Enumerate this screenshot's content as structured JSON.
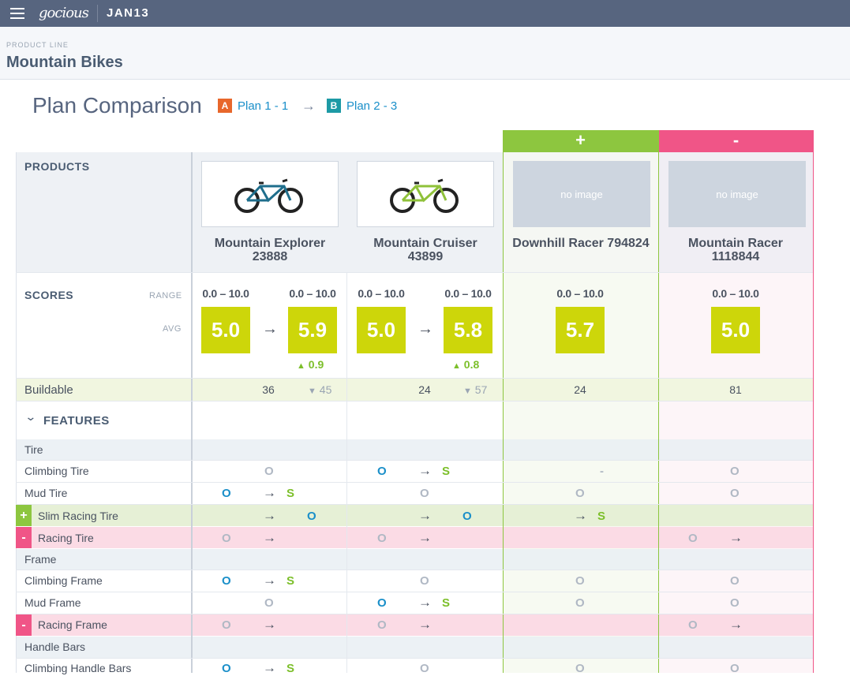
{
  "topbar": {
    "logo": "gocious",
    "project": "JAN13"
  },
  "product_line": {
    "label": "PRODUCT LINE",
    "name": "Mountain Bikes"
  },
  "page": {
    "title": "Plan Comparison"
  },
  "plans": [
    {
      "badge": "A",
      "label": "Plan 1 - 1",
      "color": "#e8672b"
    },
    {
      "badge": "B",
      "label": "Plan 2 - 3",
      "color": "#1d9aa5"
    }
  ],
  "column_headers": {
    "added": "+",
    "removed": "-"
  },
  "colors": {
    "added": "#8dc63f",
    "removed": "#f05587",
    "score": "#cdd60a",
    "link": "#1a8fc9"
  },
  "sections": {
    "products": "PRODUCTS",
    "scores": "SCORES",
    "range": "RANGE",
    "avg": "AVG",
    "buildable": "Buildable",
    "features": "FEATURES"
  },
  "products": [
    {
      "name": "Mountain Explorer",
      "id": "23888",
      "image": "bike-blue",
      "range_a": "0.0 – 10.0",
      "range_b": "0.0 – 10.0",
      "avg_a": "5.0",
      "avg_b": "5.9",
      "delta": "0.9",
      "buildable": "36",
      "buildable_b": "45"
    },
    {
      "name": "Mountain Cruiser",
      "id": "43899",
      "image": "bike-green",
      "range_a": "0.0 – 10.0",
      "range_b": "0.0 – 10.0",
      "avg_a": "5.0",
      "avg_b": "5.8",
      "delta": "0.8",
      "buildable": "24",
      "buildable_b": "57"
    },
    {
      "name": "Downhill Racer 794824",
      "id": "",
      "image": "no image",
      "range": "0.0 – 10.0",
      "avg": "5.7",
      "buildable": "24"
    },
    {
      "name": "Mountain Racer",
      "id": "1118844",
      "image": "no image",
      "range": "0.0 – 10.0",
      "avg": "5.0",
      "buildable": "81"
    }
  ],
  "features": {
    "tire_group": "Tire",
    "frame_group": "Frame",
    "handlebars_group": "Handle Bars",
    "rows": [
      {
        "label": "Climbing Tire",
        "marks": [
          "O",
          "O → S",
          "-",
          "O"
        ]
      },
      {
        "label": "Mud Tire",
        "marks": [
          "O → S",
          "O",
          "O",
          "O"
        ]
      },
      {
        "label": "Slim Racing Tire",
        "status": "+",
        "marks": [
          "→ O",
          "→ O",
          "→ S",
          ""
        ]
      },
      {
        "label": "Racing Tire",
        "status": "-",
        "marks": [
          "O →",
          "O →",
          "",
          "O →"
        ]
      },
      {
        "label": "Climbing Frame",
        "marks": [
          "O → S",
          "O",
          "O",
          "O"
        ]
      },
      {
        "label": "Mud Frame",
        "marks": [
          "O",
          "O → S",
          "O",
          "O"
        ]
      },
      {
        "label": "Racing Frame",
        "status": "-",
        "marks": [
          "O →",
          "O →",
          "",
          "O →"
        ]
      },
      {
        "label": "Climbing Handle Bars",
        "marks": [
          "O → S",
          "O",
          "O",
          "O"
        ]
      }
    ]
  },
  "glyphs": {
    "o": "O",
    "s": "S",
    "arrow": "→",
    "dash": "-",
    "chevron": "⌄",
    "up": "▲",
    "down": "▼"
  }
}
